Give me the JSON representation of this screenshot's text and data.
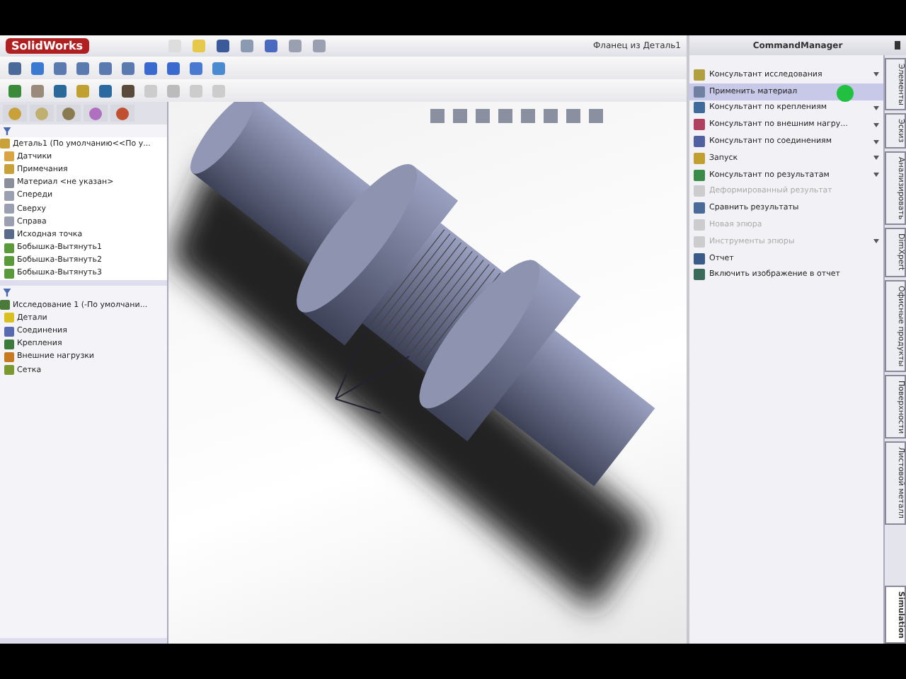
{
  "window": {
    "title": "Фланец из Деталь1",
    "logo": "SolidWorks"
  },
  "feature_tree": {
    "root": "Деталь1 (По умолчанию<<По у...",
    "items": [
      {
        "label": "Датчики"
      },
      {
        "label": "Примечания"
      },
      {
        "label": "Материал <не указан>"
      },
      {
        "label": "Спереди"
      },
      {
        "label": "Сверху"
      },
      {
        "label": "Справа"
      },
      {
        "label": "Исходная точка"
      },
      {
        "label": "Бобышка-Вытянуть1"
      },
      {
        "label": "Бобышка-Вытянуть2"
      },
      {
        "label": "Бобышка-Вытянуть3"
      }
    ]
  },
  "study_tree": {
    "root": "Исследование 1 (-По умолчани...",
    "items": [
      {
        "label": "Детали"
      },
      {
        "label": "Соединения"
      },
      {
        "label": "Крепления"
      },
      {
        "label": "Внешние нагрузки"
      },
      {
        "label": "Сетка"
      }
    ]
  },
  "command_manager": {
    "title": "CommandManager",
    "items": [
      {
        "label": "Консультант исследования",
        "selected": false,
        "disabled": false,
        "has_menu": true
      },
      {
        "label": "Применить материал",
        "selected": true,
        "disabled": false,
        "has_menu": false
      },
      {
        "label": "Консультант по креплениям",
        "selected": false,
        "disabled": false,
        "has_menu": true
      },
      {
        "label": "Консультант по внешним нагру...",
        "selected": false,
        "disabled": false,
        "has_menu": true
      },
      {
        "label": "Консультант по соединениям",
        "selected": false,
        "disabled": false,
        "has_menu": true
      },
      {
        "label": "Запуск",
        "selected": false,
        "disabled": false,
        "has_menu": true
      },
      {
        "label": "Консультант по результатам",
        "selected": false,
        "disabled": false,
        "has_menu": true
      },
      {
        "label": "Деформированный результат",
        "selected": false,
        "disabled": true,
        "has_menu": false
      },
      {
        "label": "Сравнить результаты",
        "selected": false,
        "disabled": false,
        "has_menu": false
      },
      {
        "label": "Новая эпюра",
        "selected": false,
        "disabled": true,
        "has_menu": false
      },
      {
        "label": "Инструменты эпюры",
        "selected": false,
        "disabled": true,
        "has_menu": true
      },
      {
        "label": "Отчет",
        "selected": false,
        "disabled": false,
        "has_menu": false
      },
      {
        "label": "Включить изображение в отчет",
        "selected": false,
        "disabled": false,
        "has_menu": false
      }
    ]
  },
  "side_tabs": [
    {
      "label": "Элементы",
      "selected": false
    },
    {
      "label": "Эскиз",
      "selected": false
    },
    {
      "label": "Анализировать",
      "selected": false
    },
    {
      "label": "DimXpert",
      "selected": false
    },
    {
      "label": "Офисные продукты",
      "selected": false
    },
    {
      "label": "Поверхности",
      "selected": false
    },
    {
      "label": "Листовой металл",
      "selected": false
    },
    {
      "label": "Simulation",
      "selected": true
    }
  ]
}
